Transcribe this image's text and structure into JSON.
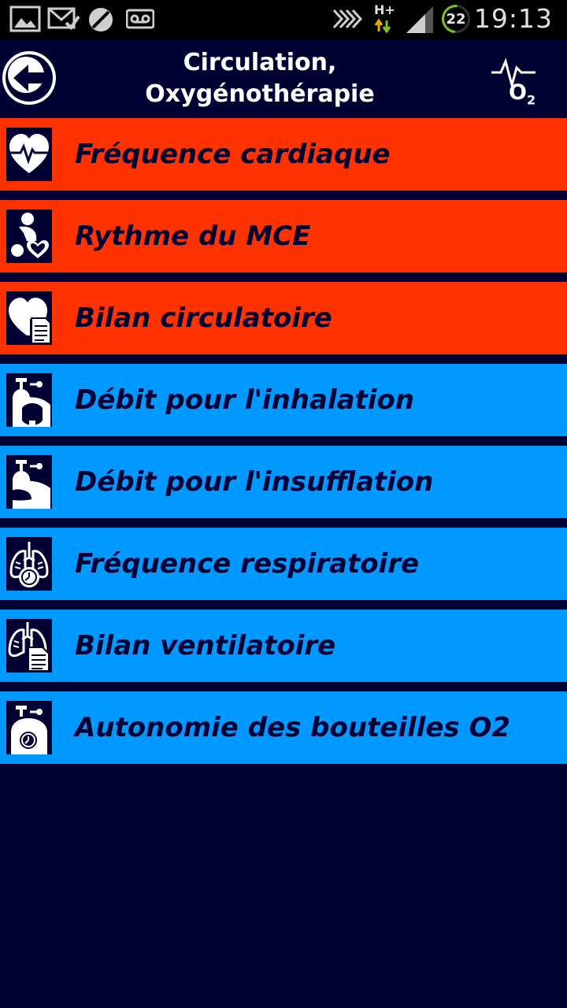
{
  "status_bar": {
    "time": "19:13",
    "battery_level": "22",
    "network": "H+",
    "icons": [
      "gallery-icon",
      "mail-check-icon",
      "blocked-icon",
      "voicemail-icon",
      "vibrate-icon",
      "signal-icon"
    ]
  },
  "header": {
    "title_line1": "Circulation,",
    "title_line2": "Oxygénothérapie",
    "o2_label": "O",
    "o2_sub": "2",
    "back_icon": "arrow-left-icon",
    "category_icon": "ecg-o2-icon"
  },
  "colors": {
    "background": "#000033",
    "circulation": "#ff3300",
    "oxygen": "#0099ff",
    "text": "#000033"
  },
  "menu": {
    "items": [
      {
        "label": "Fréquence cardiaque",
        "group": "red",
        "icon": "heart-pulse-icon"
      },
      {
        "label": "Rythme du MCE",
        "group": "red",
        "icon": "cpr-icon"
      },
      {
        "label": "Bilan circulatoire",
        "group": "red",
        "icon": "heart-report-icon"
      },
      {
        "label": "Débit pour l'inhalation",
        "group": "blue",
        "icon": "oxygen-mask-icon"
      },
      {
        "label": "Débit pour l'insufflation",
        "group": "blue",
        "icon": "oxygen-bag-icon"
      },
      {
        "label": "Fréquence respiratoire",
        "group": "blue",
        "icon": "lungs-clock-icon"
      },
      {
        "label": "Bilan ventilatoire",
        "group": "blue",
        "icon": "lungs-report-icon"
      },
      {
        "label": "Autonomie des bouteilles O2",
        "group": "blue",
        "icon": "oxygen-bottle-clock-icon"
      }
    ]
  }
}
